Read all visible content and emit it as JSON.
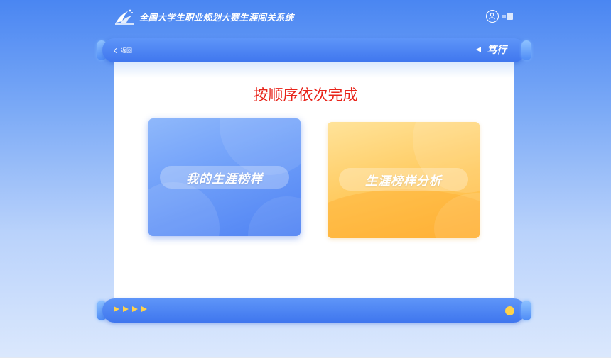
{
  "app": {
    "title": "全国大学生职业规划大赛生涯闯关系统"
  },
  "header": {
    "user_icon": "user-circle-icon",
    "menu_icon": "menu-icon"
  },
  "nav": {
    "back_label": "返回",
    "path_label": "笃行"
  },
  "main": {
    "instruction": "按顺序依次完成",
    "cards": [
      {
        "label": "我的生涯榜样",
        "color": "#5a8cf5"
      },
      {
        "label": "生涯榜样分析",
        "color": "#ffc24f"
      }
    ]
  },
  "footer": {
    "arrow_count": 4,
    "indicator_color": "#ffd24a"
  },
  "colors": {
    "brand_blue": "#4a7ff0",
    "instruction_red": "#e8241a"
  }
}
